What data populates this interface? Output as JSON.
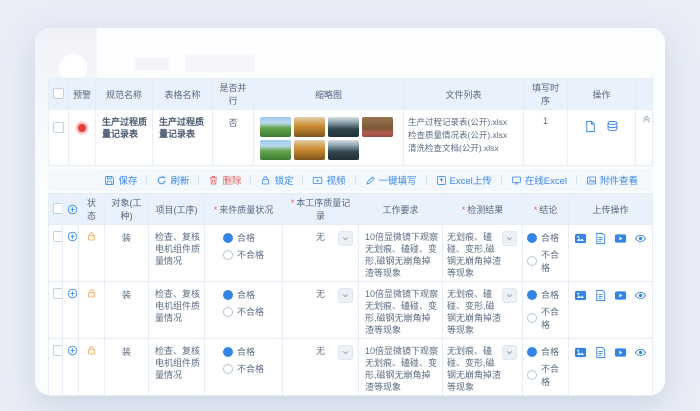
{
  "colors": {
    "accent": "#3584e4",
    "danger": "#e25f5f",
    "warning_dot": "#e23d3d",
    "lock_orange": "#efa052",
    "header_bg": "#e9f2fc",
    "page_bg": "#e9edf6",
    "card_bg": "#fcfdff"
  },
  "top_table": {
    "headers": {
      "warning": "预警",
      "spec_name": "规范名称",
      "table_name": "表格名称",
      "parallel": "是否并行",
      "thumbnail": "缩略图",
      "file_list": "文件列表",
      "fill_order": "填写时序",
      "operation": "操作"
    },
    "row": {
      "spec_name": "生产过程质量记录表",
      "table_name": "生产过程质量记录表",
      "parallel": "否",
      "files": [
        "生产过程记录表(公开).xlsx",
        "检查质量情况表(公开).xlsx",
        "清洗检查文档(公开).xlsx"
      ],
      "fill_order": "1"
    },
    "thumbnails": [
      "background:linear-gradient(180deg,#9ccaee 0%,#bcd9ec 30%,#63a54a 55%,#3e7c33 100%)",
      "background:linear-gradient(180deg,#e0cfa9 0%,#cd8c33 45%,#7e561f 100%)",
      "background:linear-gradient(180deg,#d6dee2 0%,#93a9b1 25%,#32454c 60%,#20303a 100%)",
      "background:linear-gradient(180deg,#97744f 0%,#7d5a35 55%,#b25a50 80%,#9c4a42 100%)",
      "background:linear-gradient(180deg,#9ccaee 0%,#bcd9ec 30%,#63a54a 55%,#3e7c33 100%)",
      "background:linear-gradient(180deg,#e0cfa9 0%,#cd8c33 45%,#7e561f 100%)",
      "background:linear-gradient(180deg,#d6dee2 0%,#93a9b1 25%,#32454c 60%,#20303a 100%)"
    ]
  },
  "toolbar": {
    "save": "保存",
    "refresh": "刷新",
    "delete": "删除",
    "lock": "锁定",
    "video": "视频",
    "one_click_fill": "一键填写",
    "excel_upload": "Excel上传",
    "online_excel": "在线Excel",
    "attachment_view": "附件查看"
  },
  "bottom_table": {
    "required_mark": "*",
    "headers": {
      "status": "状态",
      "worker": "对象(工种)",
      "project": "项目(工序)",
      "incoming": "来件质量状况",
      "process_record": "本工序质量记录",
      "work_req": "工作要求",
      "test_result": "检测结果",
      "conclusion": "结论",
      "upload_ops": "上传操作"
    },
    "radio": {
      "pass": "合格",
      "fail": "不合格"
    },
    "rows": [
      {
        "worker": "装",
        "project": "检查、复核电机组件质量情况",
        "incoming_selected": "合格",
        "process_record": "无",
        "work_req": "10倍显微镜下观察无划痕、磕碰、变形,磁钢无崩角掉渣等现象",
        "test_result": "无划痕、磕碰、变形,磁钢无崩角掉渣等现象",
        "conclusion_selected": "合格"
      },
      {
        "worker": "装",
        "project": "检查、复核电机组件质量情况",
        "incoming_selected": "合格",
        "process_record": "无",
        "work_req": "10倍显微镜下观察无划痕、磕碰、变形,磁钢无崩角掉渣等现象",
        "test_result": "无划痕、磕碰、变形,磁钢无崩角掉渣等现象",
        "conclusion_selected": "合格"
      },
      {
        "worker": "装",
        "project": "检查、复核电机组件质量情况",
        "incoming_selected": "合格",
        "process_record": "无",
        "work_req": "10倍显微镜下观察无划痕、磕碰、变形,磁钢无崩角掉渣等现象",
        "test_result": "无划痕、磕碰、变形,磁钢无崩角掉渣等现象",
        "conclusion_selected": "合格"
      }
    ]
  }
}
